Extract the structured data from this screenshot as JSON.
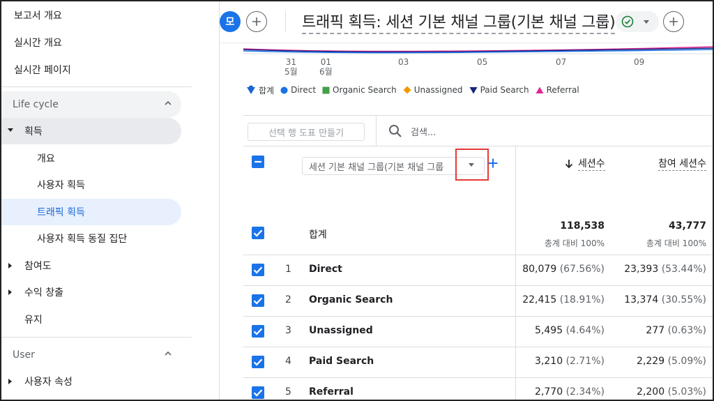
{
  "sidebar": {
    "top_items": [
      "보고서 개요",
      "실시간 개요",
      "실시간 페이지"
    ],
    "lifecycle_label": "Life cycle",
    "acquisition_label": "획득",
    "acquisition_items": [
      "개요",
      "사용자 획득",
      "트래픽 획득",
      "사용자 획득 동질 집단"
    ],
    "other_groups": [
      "참여도",
      "수익 창출",
      "유지"
    ],
    "user_label": "User",
    "user_items": [
      "사용자 속성"
    ]
  },
  "header": {
    "avatar_letter": "모",
    "title": "트래픽 획득: 세션 기본 채널 그룹(기본 채널 그룹)"
  },
  "chart": {
    "dates": [
      {
        "day": "31",
        "month": "5월"
      },
      {
        "day": "01",
        "month": "6월"
      },
      {
        "day": "03",
        "month": ""
      },
      {
        "day": "05",
        "month": ""
      },
      {
        "day": "07",
        "month": ""
      },
      {
        "day": "09",
        "month": ""
      }
    ],
    "legend": [
      {
        "label": "합계",
        "shape": "pin",
        "color": "#1967d2"
      },
      {
        "label": "Direct",
        "shape": "circle",
        "color": "#1a73e8"
      },
      {
        "label": "Organic Search",
        "shape": "square",
        "color": "#43a047"
      },
      {
        "label": "Unassigned",
        "shape": "diamond",
        "color": "#f29900"
      },
      {
        "label": "Paid Search",
        "shape": "triangle",
        "color": "#1a237e"
      },
      {
        "label": "Referral",
        "shape": "triangle",
        "color": "#e52592"
      }
    ]
  },
  "table": {
    "plot_button": "선택 행 도표 만들기",
    "search_placeholder": "검색...",
    "dimension_select": "세션 기본 채널 그룹(기본 채널 그룹",
    "metrics": [
      "세션수",
      "참여 세션수"
    ],
    "total_label": "합계",
    "totals": [
      {
        "value": "118,538",
        "note": "총계 대비 100%"
      },
      {
        "value": "43,777",
        "note": "총계 대비 100%"
      }
    ],
    "rows": [
      {
        "rank": "1",
        "channel": "Direct",
        "sessions": "80,079",
        "sessions_pct": "(67.56%)",
        "engaged": "23,393",
        "engaged_pct": "(53.44%)"
      },
      {
        "rank": "2",
        "channel": "Organic Search",
        "sessions": "22,415",
        "sessions_pct": "(18.91%)",
        "engaged": "13,374",
        "engaged_pct": "(30.55%)"
      },
      {
        "rank": "3",
        "channel": "Unassigned",
        "sessions": "5,495",
        "sessions_pct": "(4.64%)",
        "engaged": "277",
        "engaged_pct": "(0.63%)"
      },
      {
        "rank": "4",
        "channel": "Paid Search",
        "sessions": "3,210",
        "sessions_pct": "(2.71%)",
        "engaged": "2,229",
        "engaged_pct": "(5.09%)"
      },
      {
        "rank": "5",
        "channel": "Referral",
        "sessions": "2,770",
        "sessions_pct": "(2.34%)",
        "engaged": "2,200",
        "engaged_pct": "(5.03%)"
      }
    ]
  },
  "colors": {
    "accent": "#1a73e8",
    "selected_bg": "#e8f0fe",
    "highlight_box": "#e53935"
  }
}
